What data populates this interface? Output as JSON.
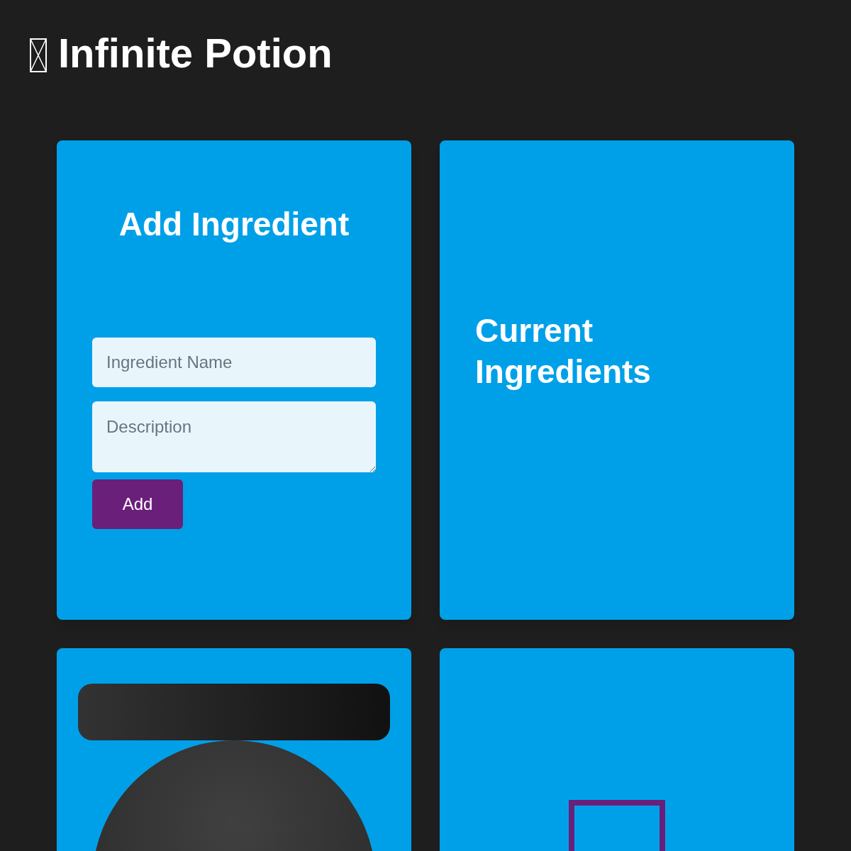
{
  "header": {
    "title": "Infinite Potion"
  },
  "add_form": {
    "heading": "Add Ingredient",
    "name_field": {
      "placeholder": "Ingredient Name"
    },
    "description_field": {
      "placeholder": "Description"
    },
    "button": "Add"
  },
  "ingredients_panel": {
    "heading": "Current Ingredients"
  }
}
